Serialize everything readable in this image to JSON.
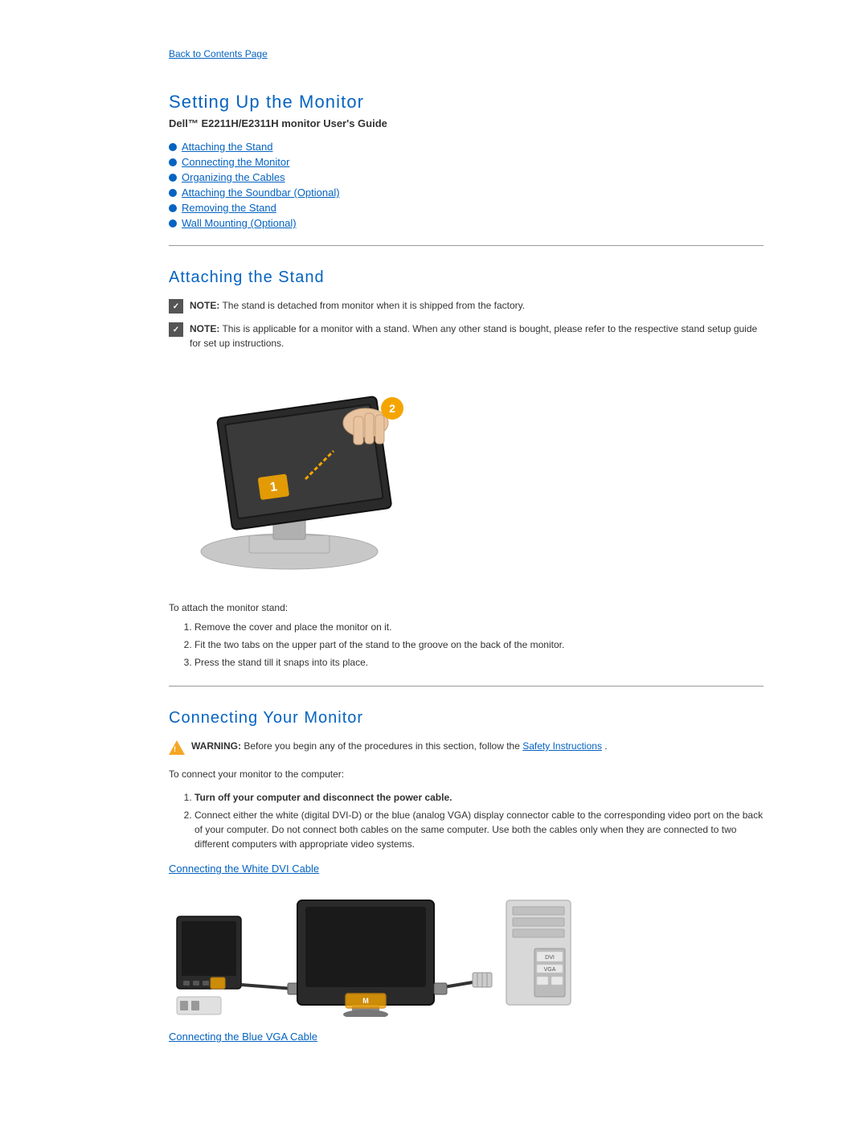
{
  "back_link": "Back to Contents Page",
  "page_title": "Setting Up the Monitor",
  "subtitle": "Dell™ E2211H/E2311H monitor User's Guide",
  "toc": {
    "items": [
      {
        "label": "Attaching the Stand",
        "href": "#attaching"
      },
      {
        "label": "Connecting the Monitor",
        "href": "#connecting"
      },
      {
        "label": "Organizing the Cables",
        "href": "#organizing"
      },
      {
        "label": "Attaching the Soundbar (Optional)",
        "href": "#soundbar"
      },
      {
        "label": "Removing the Stand",
        "href": "#removing"
      },
      {
        "label": "Wall Mounting (Optional)",
        "href": "#wall"
      }
    ]
  },
  "attaching_stand": {
    "heading": "Attaching the Stand",
    "note1_label": "NOTE:",
    "note1_text": "The stand is detached from monitor when it is shipped from the factory.",
    "note2_label": "NOTE:",
    "note2_text": "This is applicable for a monitor with a stand. When any other stand is bought, please refer to the respective stand setup guide for set up instructions.",
    "to_attach_label": "To attach the monitor stand:",
    "steps": [
      "Remove the cover and place the monitor on it.",
      "Fit the two tabs on the upper part of the stand to the groove on the back of the monitor.",
      "Press the stand till it snaps into its place."
    ]
  },
  "connecting": {
    "heading": "Connecting Your Monitor",
    "warning_label": "WARNING:",
    "warning_text": "Before you begin any of the procedures in this section, follow the",
    "warning_link": "Safety Instructions",
    "to_connect_label": "To connect your monitor to the computer:",
    "steps": [
      {
        "bold": "Turn off your computer and disconnect the power cable."
      },
      {
        "text": "Connect either the white (digital DVI-D) or the blue (analog VGA) display connector cable to the corresponding video port on the back of your computer. Do not connect both cables on the same computer. Use both the cables only when they are connected to two different computers with appropriate video systems."
      }
    ],
    "dvi_link": "Connecting the White DVI Cable",
    "vga_link": "Connecting the Blue VGA Cable"
  }
}
